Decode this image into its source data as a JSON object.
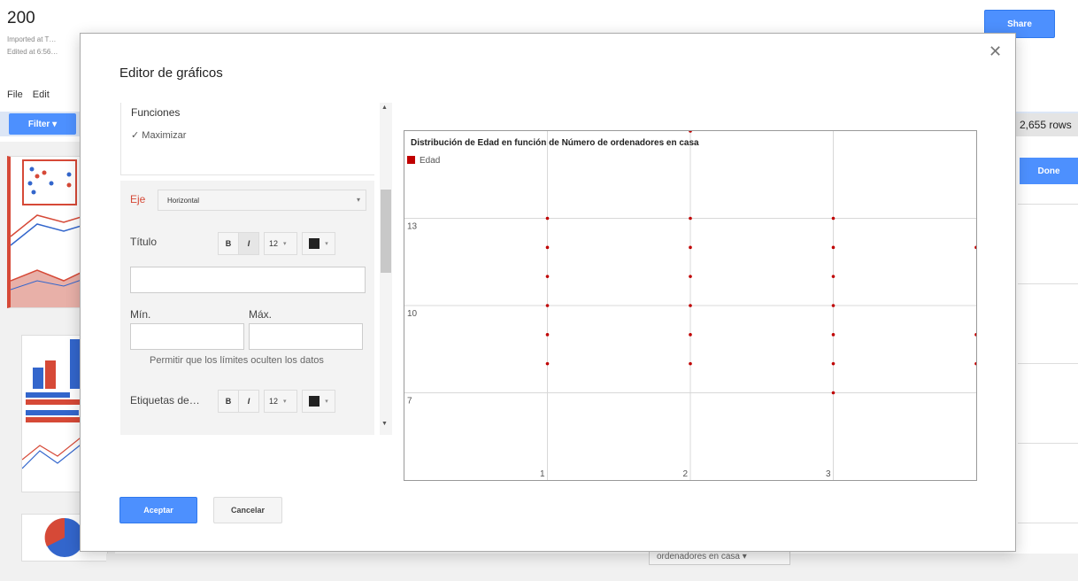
{
  "app": {
    "doc_title": "200",
    "imported": "Imported at T…",
    "edited": "Edited at 6:56…",
    "menu": [
      "File",
      "Edit"
    ],
    "share_label": "Share",
    "filter_label": "Filter",
    "rows_label": "2,655 rows",
    "done_label": "Done",
    "bottom_dropdown": "ordenadores en casa"
  },
  "dialog": {
    "title": "Editor de gráficos",
    "close_icon": "close-icon",
    "functions_title": "Funciones",
    "maximize_label": "Maximizar",
    "axis": {
      "label": "Eje",
      "selected": "Horizontal",
      "title_label": "Título",
      "min_label": "Mín.",
      "max_label": "Máx.",
      "clip_note": "Permitir que los límites oculten los datos",
      "labels_label": "Etiquetas de…",
      "bold": "B",
      "italic": "I",
      "font_size": "12"
    },
    "accept_label": "Aceptar",
    "cancel_label": "Cancelar"
  },
  "chart_data": {
    "type": "scatter",
    "title": "Distribución de Edad en función de Número de ordenadores en casa",
    "legend": [
      {
        "name": "Edad",
        "color": "#c00000"
      }
    ],
    "legend_position": "top-left",
    "x_ticks": [
      "1",
      "2",
      "3"
    ],
    "y_ticks": [
      "13",
      "10",
      "7"
    ],
    "xlim": [
      0,
      4
    ],
    "ylim": [
      4,
      16
    ],
    "grid": true,
    "series": [
      {
        "name": "Edad",
        "color": "#c00000",
        "points": [
          [
            1,
            13
          ],
          [
            1,
            12
          ],
          [
            1,
            11
          ],
          [
            1,
            10
          ],
          [
            1,
            9
          ],
          [
            1,
            8
          ],
          [
            2,
            16
          ],
          [
            2,
            13
          ],
          [
            2,
            12
          ],
          [
            2,
            11
          ],
          [
            2,
            10
          ],
          [
            2,
            9
          ],
          [
            2,
            8
          ],
          [
            3,
            13
          ],
          [
            3,
            12
          ],
          [
            3,
            11
          ],
          [
            3,
            10
          ],
          [
            3,
            9
          ],
          [
            3,
            8
          ],
          [
            3,
            7
          ],
          [
            4,
            12
          ],
          [
            4,
            9
          ],
          [
            4,
            8
          ]
        ]
      }
    ]
  }
}
